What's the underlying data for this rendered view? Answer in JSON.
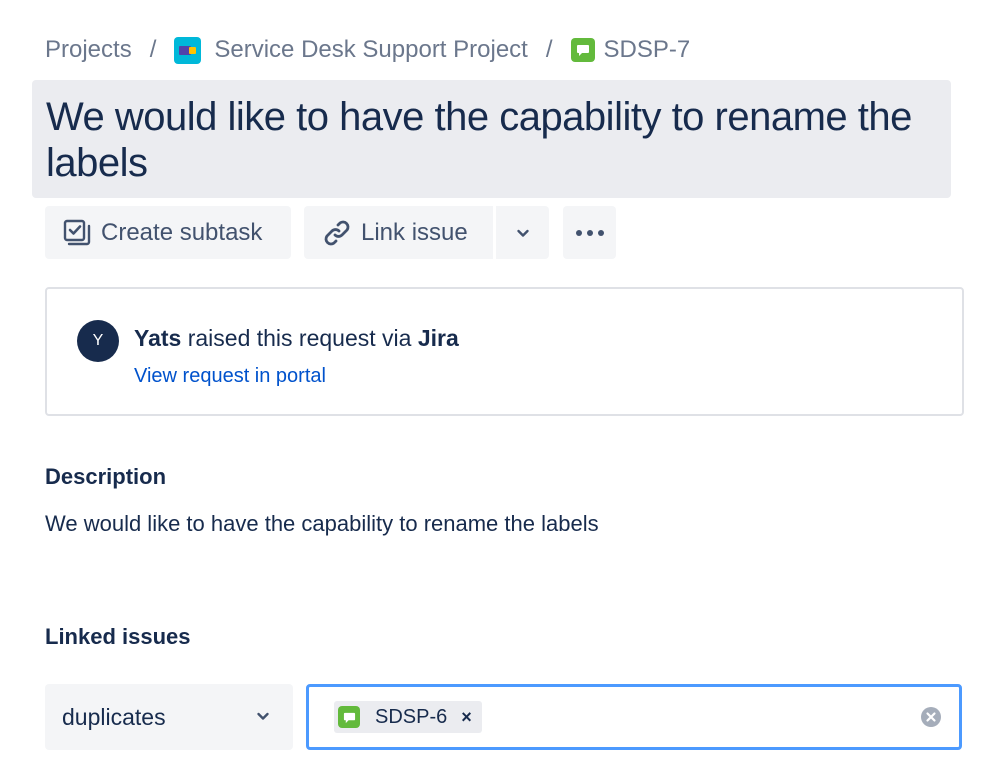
{
  "breadcrumb": {
    "projects_label": "Projects",
    "separator": "/",
    "project_name": "Service Desk Support Project",
    "issue_key": "SDSP-7"
  },
  "issue": {
    "title": "We would like to have the capability to rename the labels"
  },
  "toolbar": {
    "create_subtask_label": "Create subtask",
    "link_issue_label": "Link issue"
  },
  "request": {
    "avatar_initial": "Y",
    "reporter": "Yats",
    "raised_text": "raised this request via",
    "channel": "Jira",
    "portal_link_label": "View request in portal"
  },
  "description": {
    "heading": "Description",
    "text": "We would like to have the capability to rename the labels"
  },
  "linked_issues": {
    "heading": "Linked issues",
    "link_type_selected": "duplicates",
    "selected_issues": [
      {
        "key": "SDSP-6",
        "remove_label": "×"
      }
    ]
  },
  "colors": {
    "text_primary": "#172b4d",
    "text_secondary": "#6b778c",
    "link": "#0052cc",
    "focus_border": "#4c9aff",
    "issue_type_green": "#63ba3c",
    "project_icon_blue": "#00b8d9",
    "button_bg": "#f4f5f7",
    "title_bg": "#ebecf0"
  },
  "icons": {
    "project": "service-desk-project-icon",
    "issue_type": "service-request-icon",
    "create_subtask": "subtask-icon",
    "link_issue": "link-icon",
    "dropdown": "chevron-down-icon",
    "more": "more-icon",
    "clear": "clear-icon"
  }
}
